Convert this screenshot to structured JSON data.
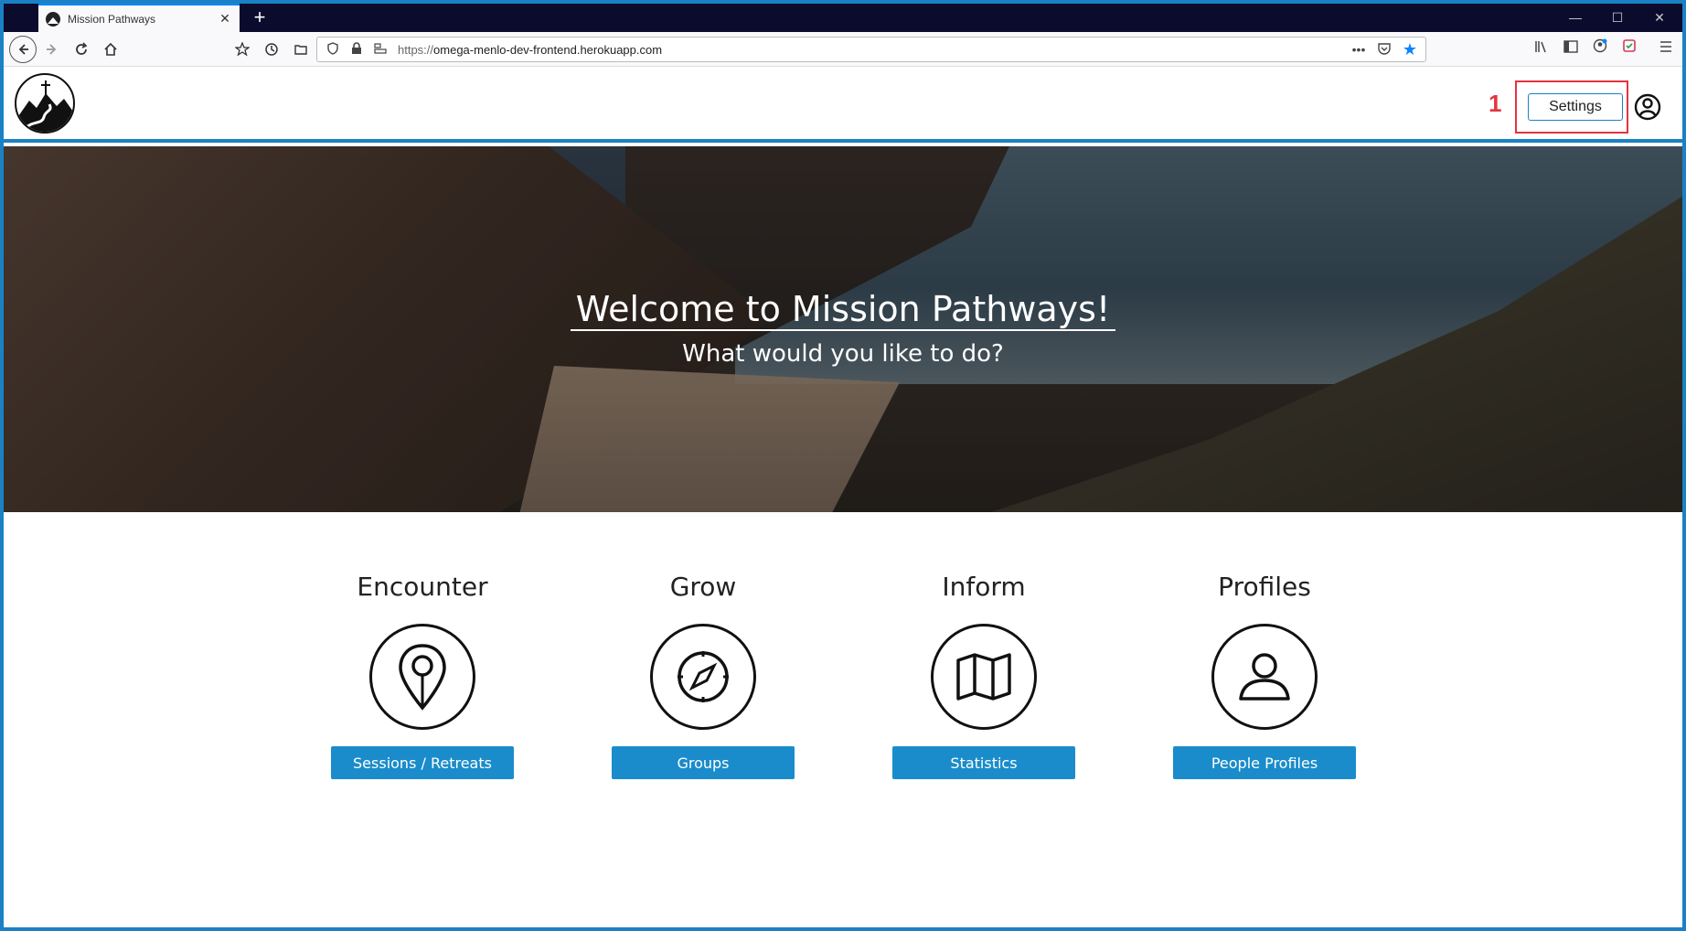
{
  "browser": {
    "tab_title": "Mission Pathways",
    "tab_close": "✕",
    "new_tab": "+",
    "url_protocol": "https://",
    "url_host": "omega-menlo-dev-frontend.herokuapp.com",
    "window_controls": {
      "minimize": "—",
      "maximize": "☐",
      "close": "✕"
    }
  },
  "header": {
    "settings_label": "Settings",
    "annotation_label": "1"
  },
  "hero": {
    "title": "Welcome to Mission Pathways!",
    "subtitle": "What would you like to do?"
  },
  "features": [
    {
      "heading": "Encounter",
      "icon": "map-pin-icon",
      "button": "Sessions / Retreats"
    },
    {
      "heading": "Grow",
      "icon": "compass-icon",
      "button": "Groups"
    },
    {
      "heading": "Inform",
      "icon": "map-icon",
      "button": "Statistics"
    },
    {
      "heading": "Profiles",
      "icon": "person-icon",
      "button": "People Profiles"
    }
  ],
  "colors": {
    "accent": "#1a82c4",
    "button": "#1a8ccb",
    "annotation": "#e3343f"
  }
}
